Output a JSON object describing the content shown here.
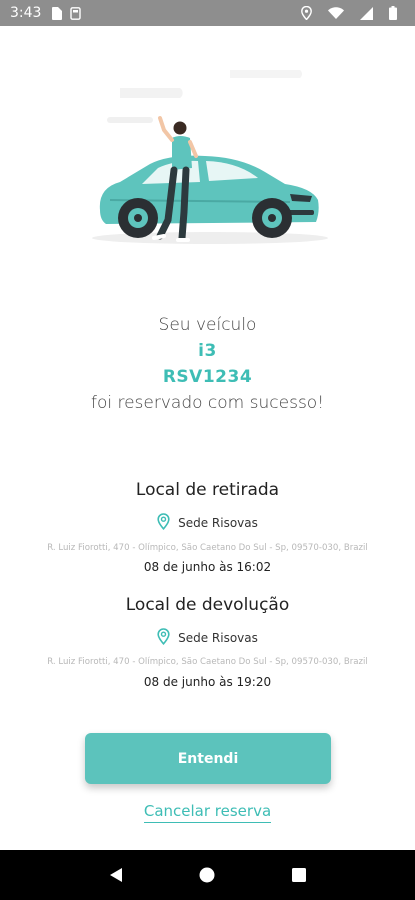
{
  "status_bar": {
    "time": "3:43"
  },
  "message": {
    "line1": "Seu veículo",
    "model": "i3",
    "plate": "RSV1234",
    "line2": "foi reservado com sucesso!"
  },
  "pickup": {
    "title": "Local de retirada",
    "place": "Sede Risovas",
    "address": "R. Luiz Fiorotti, 470 - Olímpico, São Caetano Do Sul - Sp, 09570-030, Brazil",
    "datetime": "08 de junho às 16:02"
  },
  "dropoff": {
    "title": "Local de devolução",
    "place": "Sede Risovas",
    "address": "R. Luiz Fiorotti, 470 - Olímpico, São Caetano Do Sul - Sp, 09570-030, Brazil",
    "datetime": "08 de junho às 19:20"
  },
  "actions": {
    "confirm_label": "Entendi",
    "cancel_label": "Cancelar reserva"
  },
  "colors": {
    "accent": "#3ebdb5",
    "button": "#5cc3bc",
    "status_bar": "#8e8e8e",
    "nav_bar": "#000000"
  },
  "icons": [
    "sim-card-icon",
    "sd-card-icon",
    "location-icon",
    "wifi-icon",
    "signal-icon",
    "battery-icon",
    "map-pin-icon",
    "back-icon",
    "home-icon",
    "recents-icon"
  ]
}
